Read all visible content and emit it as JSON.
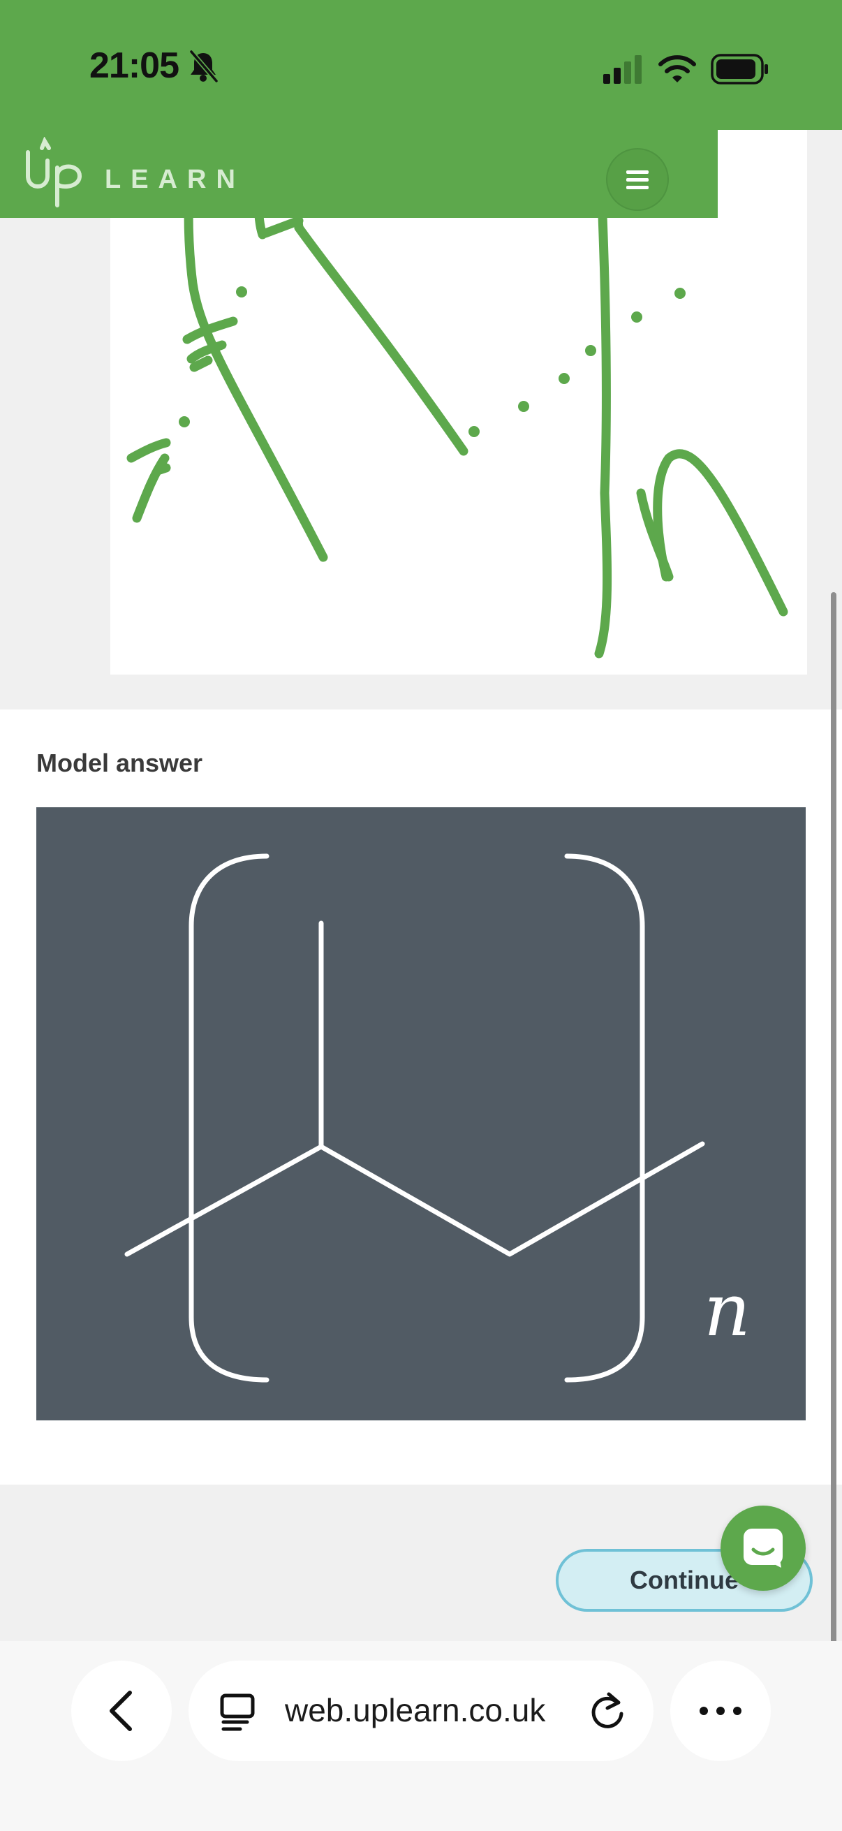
{
  "status_bar": {
    "time": "21:05",
    "icons": [
      "bell-slash-icon",
      "cellular-signal-icon",
      "wifi-icon",
      "battery-icon"
    ]
  },
  "header": {
    "logo_text": "LEARN",
    "menu_icon": "hamburger-menu-icon",
    "brand_color": "#5da84c"
  },
  "model_answer": {
    "title": "Model answer",
    "subscript_label": "n",
    "image_background": "#515b64"
  },
  "footer": {
    "continue_label": "Continue",
    "chat_icon": "chat-bubble-icon",
    "button_color": "#d3eef3"
  },
  "browser": {
    "url": "web.uplearn.co.uk",
    "icons": [
      "back-chevron-icon",
      "tabs-icon",
      "reload-icon",
      "more-dots-icon"
    ]
  }
}
